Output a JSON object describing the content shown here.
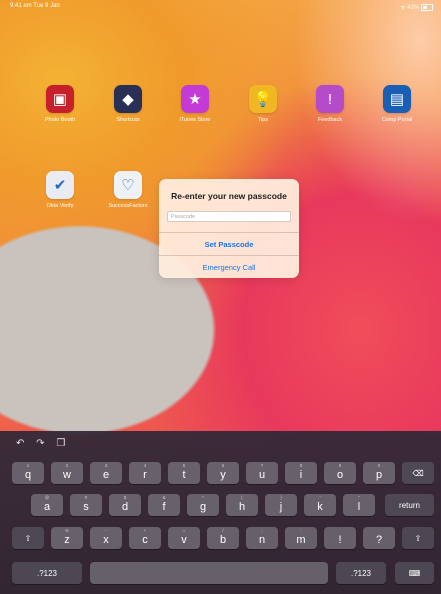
{
  "status_bar": {
    "time_date": "9:41 am  Tue 9 Jan",
    "battery": "42%"
  },
  "apps": [
    {
      "name": "Photo Booth",
      "icon": "photo-booth-icon",
      "color": "#c6202a",
      "glyph": "▣"
    },
    {
      "name": "Shortcuts",
      "icon": "shortcuts-icon",
      "color": "#2a2f56",
      "glyph": "◆"
    },
    {
      "name": "iTunes Store",
      "icon": "itunes-store-icon",
      "color": "#c33ad6",
      "glyph": "★"
    },
    {
      "name": "Tips",
      "icon": "tips-icon",
      "color": "#f0b624",
      "glyph": "💡"
    },
    {
      "name": "Feedback",
      "icon": "feedback-icon",
      "color": "#b54bc9",
      "glyph": "!"
    },
    {
      "name": "Comp Portal",
      "icon": "comp-portal-icon",
      "color": "#1a5fb4",
      "glyph": "▤"
    },
    {
      "name": "Okta Verify",
      "icon": "okta-verify-icon",
      "color": "#e9edf3",
      "glyph": "✔"
    },
    {
      "name": "SuccessFactors",
      "icon": "successfactors-icon",
      "color": "#eef1f6",
      "glyph": "♡"
    }
  ],
  "dialog": {
    "title": "Re-enter your new passcode",
    "placeholder": "Passcode",
    "primary_button": "Set Passcode",
    "secondary_button": "Emergency Call"
  },
  "keyboard": {
    "row1": [
      {
        "hint": "1",
        "key": "q"
      },
      {
        "hint": "2",
        "key": "w"
      },
      {
        "hint": "3",
        "key": "e"
      },
      {
        "hint": "4",
        "key": "r"
      },
      {
        "hint": "5",
        "key": "t"
      },
      {
        "hint": "6",
        "key": "y"
      },
      {
        "hint": "7",
        "key": "u"
      },
      {
        "hint": "8",
        "key": "i"
      },
      {
        "hint": "9",
        "key": "o"
      },
      {
        "hint": "0",
        "key": "p"
      }
    ],
    "row2": [
      {
        "hint": "@",
        "key": "a"
      },
      {
        "hint": "#",
        "key": "s"
      },
      {
        "hint": "$",
        "key": "d"
      },
      {
        "hint": "&",
        "key": "f"
      },
      {
        "hint": "*",
        "key": "g"
      },
      {
        "hint": "(",
        "key": "h"
      },
      {
        "hint": ")",
        "key": "j"
      },
      {
        "hint": "'",
        "key": "k"
      },
      {
        "hint": "\"",
        "key": "l"
      }
    ],
    "row3": [
      {
        "hint": "%",
        "key": "z"
      },
      {
        "hint": "-",
        "key": "x"
      },
      {
        "hint": "+",
        "key": "c"
      },
      {
        "hint": "=",
        "key": "v"
      },
      {
        "hint": "/",
        "key": "b"
      },
      {
        "hint": ";",
        "key": "n"
      },
      {
        "hint": ":",
        "key": "m"
      },
      {
        "hint": "",
        "key": "!"
      },
      {
        "hint": "",
        "key": "?"
      }
    ],
    "return_label": "return",
    "numbers_label": ".?123",
    "delete_glyph": "⌫",
    "shift_glyph": "⇧",
    "hide_glyph": "⌨",
    "undo_glyph": "↶",
    "redo_glyph": "↷",
    "paste_glyph": "❐"
  }
}
